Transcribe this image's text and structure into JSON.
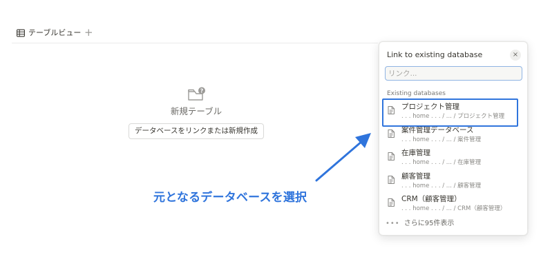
{
  "view_tab": {
    "label": "テーブルビュー",
    "add_symbol": "+"
  },
  "empty_state": {
    "title": "新規テーブル",
    "button_label": "データベースをリンクまたは新規作成"
  },
  "annotation": {
    "text": "元となるデータベースを選択"
  },
  "panel": {
    "title": "Link to existing database",
    "close_symbol": "×",
    "search_placeholder": "リンク...",
    "section_label": "Existing databases",
    "items": [
      {
        "name": "プロジェクト管理",
        "path": ". . . home . . . / ... / プロジェクト管理"
      },
      {
        "name": "案件管理データベース",
        "path": ". . . home . . . / ... / 案件管理"
      },
      {
        "name": "在庫管理",
        "path": ". . . home . . . / ... / 在庫管理"
      },
      {
        "name": "顧客管理",
        "path": ". . . home . . . / ... / 顧客管理"
      },
      {
        "name": "CRM（顧客管理）",
        "path": ". . . home . . . / ... / CRM（顧客管理）"
      }
    ],
    "more_dots": "•••",
    "more_label": "さらに95件表示"
  },
  "colors": {
    "accent": "#2f74dc",
    "text": "#37352f",
    "muted": "#787774"
  },
  "icons": {
    "view": "table-icon",
    "empty": "folder-question-icon",
    "item": "document-icon"
  }
}
